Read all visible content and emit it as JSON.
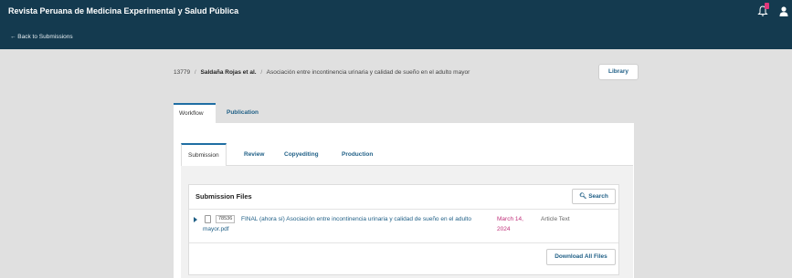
{
  "header": {
    "journal_title": "Revista Peruana de Medicina Experimental y Salud Pública",
    "back_link": "← Back to Submissions",
    "notification_count": "1",
    "brand_color": "#143a4f",
    "icons": {
      "notifications": "bell-icon",
      "user": "user-icon"
    }
  },
  "breadcrumb": {
    "submission_id": "13779",
    "authors": "Saldaña Rojas et al.",
    "title": "Asociación entre incontinencia urinaria y calidad de sueño en el adulto mayor",
    "separator": "/"
  },
  "library_button": "Library",
  "main_tabs": [
    {
      "label": "Workflow",
      "active": true
    },
    {
      "label": "Publication",
      "active": false
    }
  ],
  "stage_tabs": [
    {
      "label": "Submission",
      "active": true
    },
    {
      "label": "Review",
      "active": false
    },
    {
      "label": "Copyediting",
      "active": false
    },
    {
      "label": "Production",
      "active": false
    }
  ],
  "submission_files": {
    "title": "Submission Files",
    "search_label": "Search",
    "files": [
      {
        "id": "78536",
        "name": "FINAL (ahora sí) Asociación entre incontinencia urinaria y calidad de sueño en el adulto mayor.pdf",
        "date": "March 14, 2024",
        "type": "Article Text"
      }
    ],
    "download_all_label": "Download All Files"
  },
  "colors": {
    "link": "#1f5f86",
    "date": "#c0307a",
    "accent": "#1f6ea3",
    "badge": "#e0377a"
  }
}
